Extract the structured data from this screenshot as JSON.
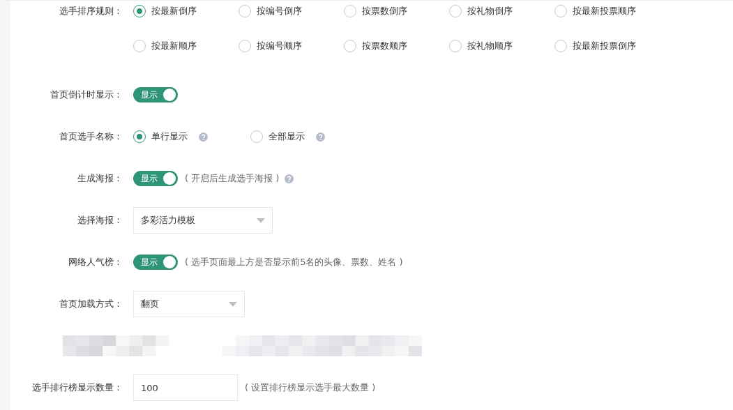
{
  "rows": [
    {
      "kind": "radio",
      "label": "选手排序规则：",
      "options": [
        {
          "label": "按最新倒序",
          "selected": true
        },
        {
          "label": "按编号倒序",
          "selected": false
        },
        {
          "label": "按票数倒序",
          "selected": false
        },
        {
          "label": "按礼物倒序",
          "selected": false
        },
        {
          "label": "按最新投票顺序",
          "selected": false
        },
        {
          "label": "按最新顺序",
          "selected": false
        },
        {
          "label": "按编号顺序",
          "selected": false
        },
        {
          "label": "按票数顺序",
          "selected": false
        },
        {
          "label": "按礼物顺序",
          "selected": false
        },
        {
          "label": "按最新投票倒序",
          "selected": false
        }
      ]
    },
    {
      "kind": "toggle",
      "label": "首页倒计时显示：",
      "toggle": {
        "text": "显示",
        "on": true
      }
    },
    {
      "kind": "radio",
      "label": "首页选手名称：",
      "options": [
        {
          "label": "单行显示",
          "selected": true,
          "help": true
        },
        {
          "label": "全部显示",
          "selected": false,
          "help": true
        }
      ]
    },
    {
      "kind": "toggle",
      "label": "生成海报：",
      "toggle": {
        "text": "显示",
        "on": true
      },
      "note": "( 开启后生成选手海报 )",
      "help": true
    },
    {
      "kind": "select",
      "label": "选择海报：",
      "value": "多彩活力模板"
    },
    {
      "kind": "toggle",
      "label": "网络人气榜：",
      "toggle": {
        "text": "显示",
        "on": true
      },
      "note": "( 选手页面最上方是否显示前5名的头像、票数、姓名 )"
    },
    {
      "kind": "select",
      "label": "首页加载方式：",
      "value": "翻页"
    },
    {
      "kind": "blurred"
    },
    {
      "kind": "input",
      "label": "选手排行榜显示数量：",
      "value": "100",
      "note": "( 设置排行榜显示选手最大数量 )"
    }
  ]
}
